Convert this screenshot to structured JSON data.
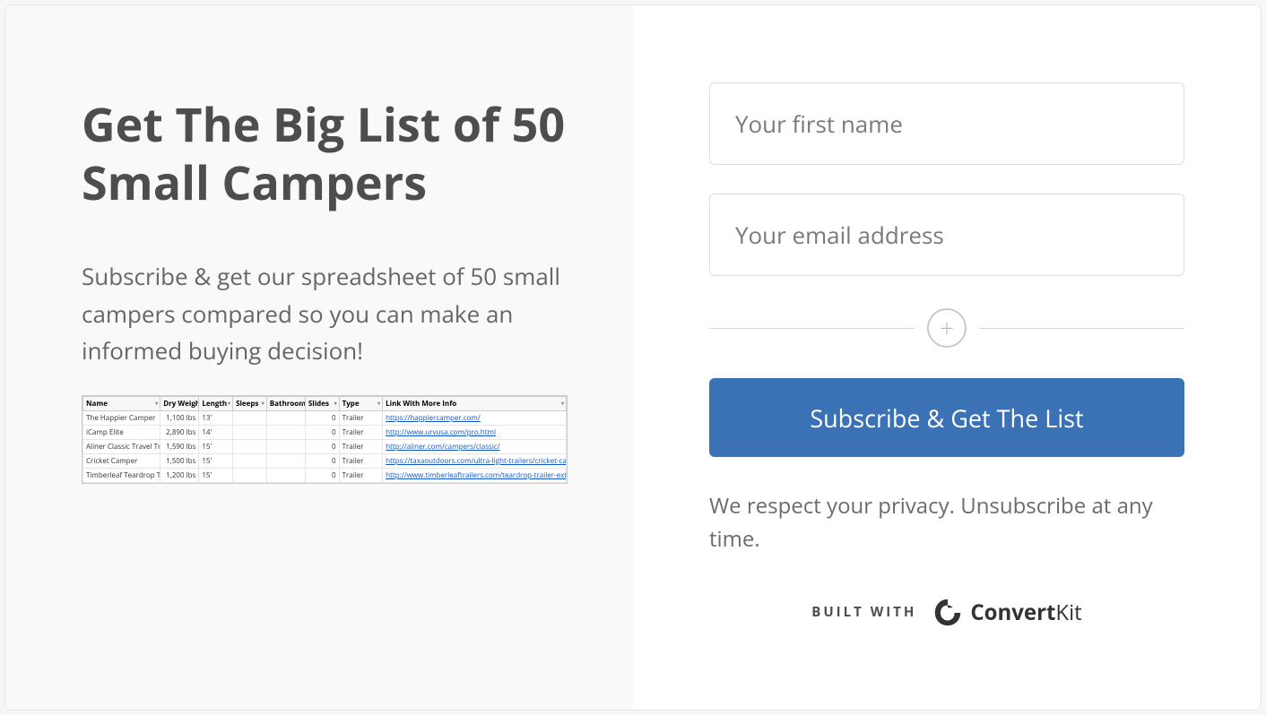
{
  "left": {
    "headline": "Get The Big List of 50 Small Campers",
    "subheadline": "Subscribe & get our spreadsheet of 50 small campers compared so you can make an informed buying decision!",
    "spreadsheet": {
      "headers": [
        "Name",
        "Dry Weight",
        "Length",
        "Sleeps",
        "Bathroom",
        "Slides",
        "Type",
        "Link With More Info"
      ],
      "rows": [
        {
          "name": "The Happier Camper",
          "weight": "1,100 lbs",
          "length": "13'",
          "sleeps": "",
          "bathroom": "",
          "slides": "0",
          "type": "Trailer",
          "link": "https://happiercamper.com/"
        },
        {
          "name": "iCamp Elite",
          "weight": "2,890 lbs",
          "length": "14'",
          "sleeps": "",
          "bathroom": "",
          "slides": "0",
          "type": "Trailer",
          "link": "http://www.urvusa.com/pro.html"
        },
        {
          "name": "Aliner Classic Travel Trailer",
          "weight": "1,590 lbs",
          "length": "15'",
          "sleeps": "",
          "bathroom": "",
          "slides": "0",
          "type": "Trailer",
          "link": "http://aliner.com/campers/classic/"
        },
        {
          "name": "Cricket Camper",
          "weight": "1,500 lbs",
          "length": "15'",
          "sleeps": "",
          "bathroom": "",
          "slides": "0",
          "type": "Trailer",
          "link": "https://taxaoutdoors.com/ultra-light-trailers/cricket-camper-trailer/"
        },
        {
          "name": "Timberleaf Teardrop Trailer",
          "weight": "1,200 lbs",
          "length": "15'",
          "sleeps": "",
          "bathroom": "",
          "slides": "0",
          "type": "Trailer",
          "link": "http://www.timberleaftrailers.com/teardrop-trailer-exterior/"
        }
      ]
    }
  },
  "form": {
    "first_name_placeholder": "Your first name",
    "email_placeholder": "Your email address",
    "submit_label": "Subscribe & Get The List",
    "privacy_text": "We respect your privacy. Unsubscribe at any time."
  },
  "footer": {
    "built_with_label": "BUILT WITH",
    "brand_convert": "Convert",
    "brand_kit": "Kit"
  }
}
